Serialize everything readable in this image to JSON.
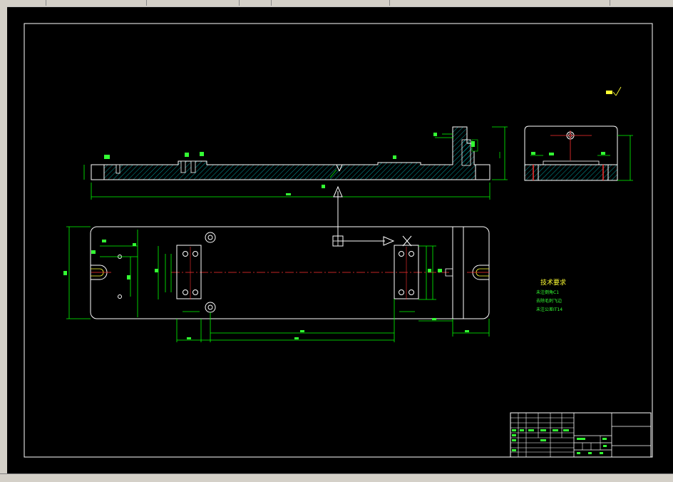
{
  "window": {
    "top_strip_tick_count": 6
  },
  "drawing": {
    "technical_requirements": {
      "title": "技术要求",
      "lines": [
        "未注倒角C1",
        "去除毛刺飞边",
        "未注公差IT14"
      ]
    },
    "colors": {
      "background": "#000000",
      "frame": "#ffffff",
      "outline": "#ffffff",
      "dimension": "#00ff00",
      "center_line": "#ff3030",
      "hatch": "#00c8c8",
      "annotation": "#ffff00"
    }
  },
  "cursor": {
    "type": "crosshair"
  }
}
